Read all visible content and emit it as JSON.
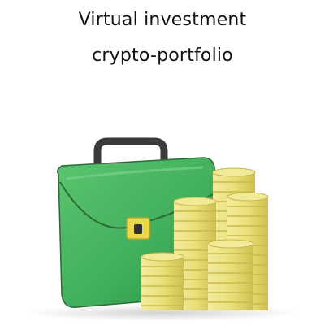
{
  "title": {
    "line1": "Virtual investment",
    "line2": "crypto-portfolio"
  },
  "illustration": {
    "subject": "green briefcase with stacks of gold coins",
    "colors": {
      "briefcase": "#3fae5a",
      "briefcase_dark": "#2c8a44",
      "handle": "#3a3a3a",
      "clasp": "#e8d84a",
      "coin": "#e9e07a",
      "coin_shadow": "#c9b94a"
    }
  }
}
